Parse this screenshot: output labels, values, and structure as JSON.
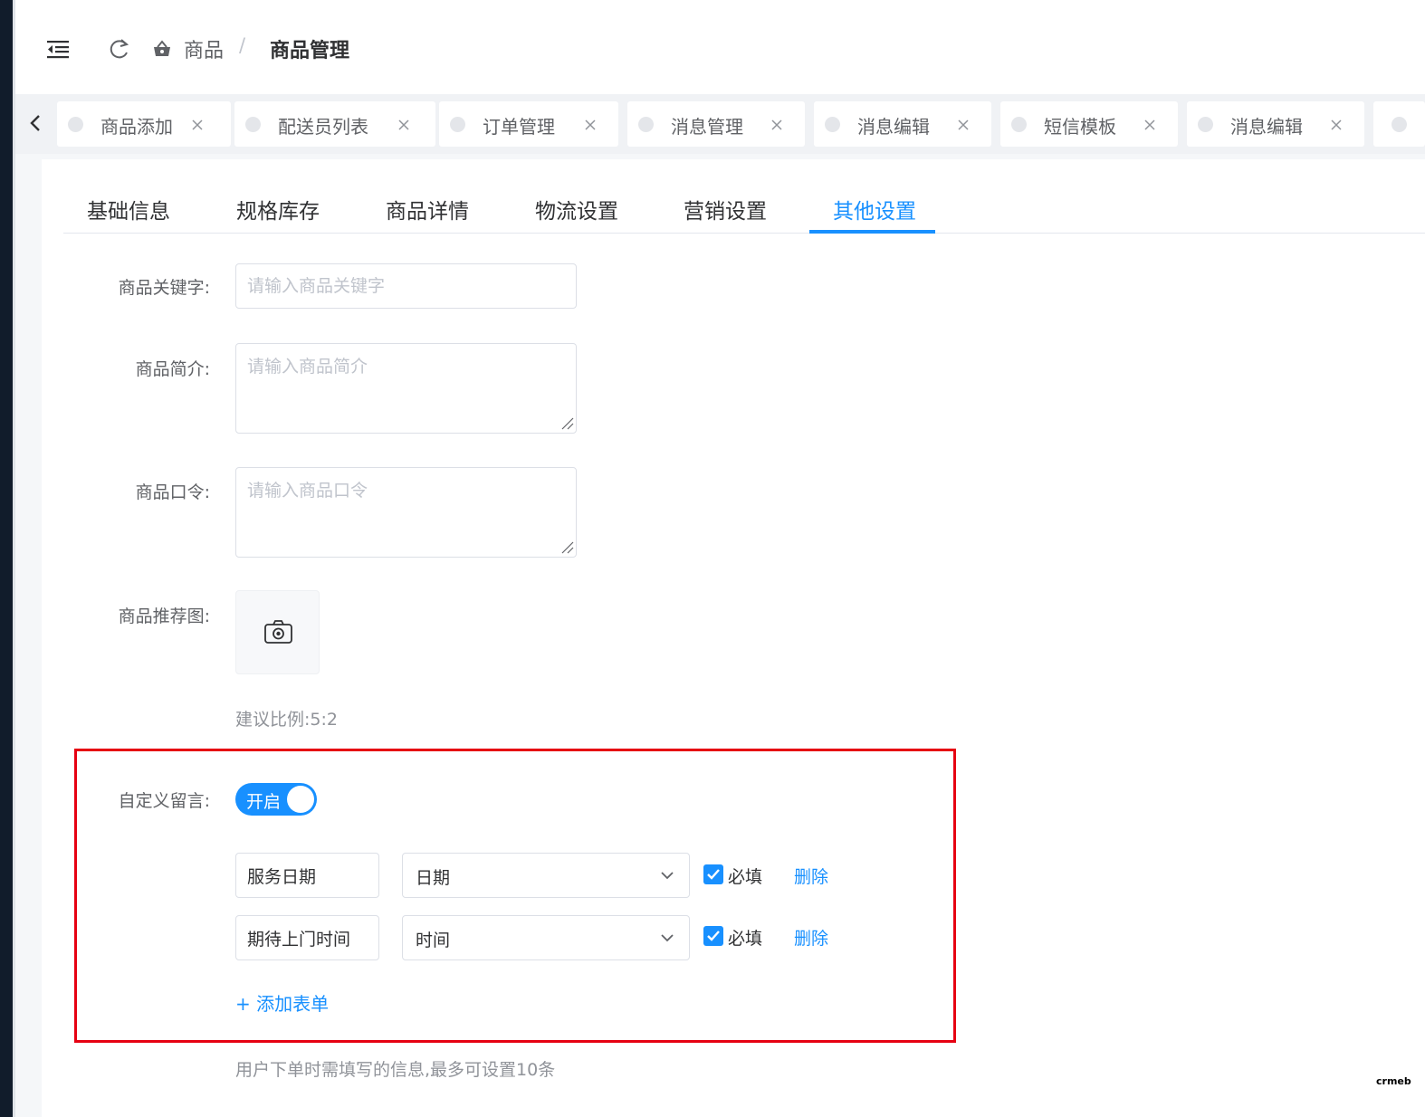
{
  "header": {
    "breadcrumb_root": "商品",
    "breadcrumb_separator": "/",
    "breadcrumb_current": "商品管理"
  },
  "tags": [
    {
      "label": "商品添加"
    },
    {
      "label": "配送员列表"
    },
    {
      "label": "订单管理"
    },
    {
      "label": "消息管理"
    },
    {
      "label": "消息编辑"
    },
    {
      "label": "短信模板"
    },
    {
      "label": "消息编辑"
    }
  ],
  "tabs": [
    {
      "label": "基础信息",
      "active": false
    },
    {
      "label": "规格库存",
      "active": false
    },
    {
      "label": "商品详情",
      "active": false
    },
    {
      "label": "物流设置",
      "active": false
    },
    {
      "label": "营销设置",
      "active": false
    },
    {
      "label": "其他设置",
      "active": true
    }
  ],
  "form": {
    "keyword_label": "商品关键字:",
    "keyword_placeholder": "请输入商品关键字",
    "intro_label": "商品简介:",
    "intro_placeholder": "请输入商品简介",
    "password_label": "商品口令:",
    "password_placeholder": "请输入商品口令",
    "image_label": "商品推荐图:",
    "image_hint": "建议比例:5:2",
    "custom_msg_label": "自定义留言:",
    "custom_msg_switch_text": "开启",
    "custom_msg_enabled": true,
    "custom_fields": [
      {
        "name": "服务日期",
        "type": "日期",
        "required": true,
        "required_label": "必填",
        "delete_label": "删除"
      },
      {
        "name": "期待上门时间",
        "type": "时间",
        "required": true,
        "required_label": "必填",
        "delete_label": "删除"
      }
    ],
    "add_form_label": "+ 添加表单",
    "custom_msg_hint": "用户下单时需填写的信息,最多可设置10条"
  },
  "colors": {
    "primary": "#1890ff",
    "highlight_border": "#e60012",
    "sidebar": "#111c2b"
  },
  "watermark": "crmeb"
}
